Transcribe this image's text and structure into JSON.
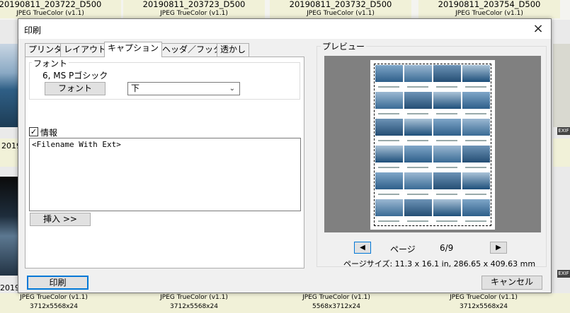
{
  "background": {
    "top_captions": [
      {
        "name": "20190811_203722_D500",
        "type": "JPEG TrueColor (v1.1)"
      },
      {
        "name": "20190811_203723_D500",
        "type": "JPEG TrueColor (v1.1)"
      },
      {
        "name": "20190811_203732_D500",
        "type": "JPEG TrueColor (v1.1)"
      },
      {
        "name": "20190811_203754_D500",
        "type": "JPEG TrueColor (v1.1)"
      }
    ],
    "mid_left_label": "2019",
    "row2_left_label": "20190",
    "bottom_captions": [
      {
        "type": "JPEG TrueColor (v1.1)",
        "dims": "3712x5568x24"
      },
      {
        "type": "JPEG TrueColor (v1.1)",
        "dims": "3712x5568x24"
      },
      {
        "type": "JPEG TrueColor (v1.1)",
        "dims": "5568x3712x24"
      },
      {
        "type": "JPEG TrueColor (v1.1)",
        "dims": "3712x5568x24"
      }
    ],
    "exif_badge": "EXIF"
  },
  "dialog": {
    "title": "印刷",
    "close_icon": "×",
    "tabs": [
      {
        "label": "プリンタ",
        "active": false
      },
      {
        "label": "レイアウト",
        "active": false
      },
      {
        "label": "キャプション",
        "active": true
      },
      {
        "label": "ヘッダ／フッタ",
        "active": false
      },
      {
        "label": "透かし",
        "active": false
      }
    ],
    "font_group": {
      "label": "フォント",
      "current_font": "6, MS Pゴシック",
      "font_button": "フォント",
      "position_select": "下"
    },
    "info_group": {
      "checked": true,
      "checkbox_label": "情報",
      "template_text": "<Filename With Ext>",
      "insert_button": "挿入 >>"
    },
    "preview": {
      "label": "プレビュー",
      "page_label": "ページ",
      "page_indicator": "6/9",
      "page_size": "ページサイズ: 11.3 x 16.1 in, 286.65 x 409.63 mm",
      "prev_icon": "triangle-left",
      "next_icon": "triangle-right"
    },
    "print_button": "印刷",
    "cancel_button": "キャンセル"
  }
}
